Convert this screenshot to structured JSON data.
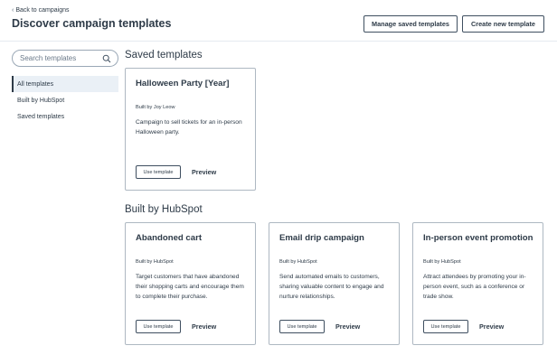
{
  "header": {
    "back_label": "Back to campaigns",
    "title": "Discover campaign templates",
    "manage_label": "Manage saved templates",
    "create_label": "Create new template"
  },
  "sidebar": {
    "search_placeholder": "Search templates",
    "items": [
      {
        "label": "All templates",
        "active": true
      },
      {
        "label": "Built by HubSpot",
        "active": false
      },
      {
        "label": "Saved templates",
        "active": false
      }
    ]
  },
  "saved_section": {
    "title": "Saved templates",
    "cards": [
      {
        "title": "Halloween Party [Year]",
        "builder": "Built by Joy Leow",
        "description": "Campaign to sell tickets for an in-person Halloween party.",
        "use_label": "Use template",
        "preview_label": "Preview"
      }
    ]
  },
  "hubspot_section": {
    "title": "Built by HubSpot",
    "cards": [
      {
        "title": "Abandoned cart",
        "builder": "Built by HubSpot",
        "description": "Target customers that have abandoned their shopping carts and encourage them to complete their purchase.",
        "use_label": "Use template",
        "preview_label": "Preview"
      },
      {
        "title": "Email drip campaign",
        "builder": "Built by HubSpot",
        "description": "Send automated emails to customers, sharing valuable content to engage and nurture relationships.",
        "use_label": "Use template",
        "preview_label": "Preview"
      },
      {
        "title": "In-person event promotion",
        "builder": "Built by HubSpot",
        "description": "Attract attendees by promoting your in-person event, such as a conference or trade show.",
        "use_label": "Use template",
        "preview_label": "Preview"
      }
    ]
  }
}
